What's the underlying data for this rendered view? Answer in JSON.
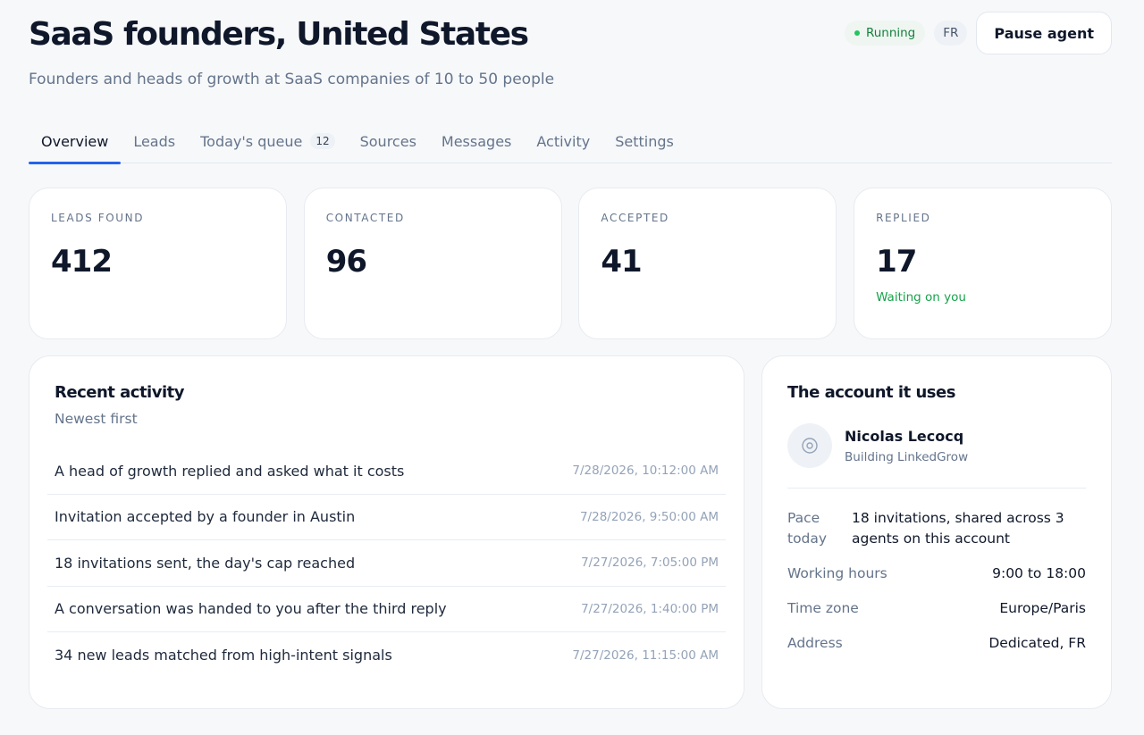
{
  "header": {
    "title": "SaaS founders, United States",
    "subtitle": "Founders and heads of growth at SaaS companies of 10 to 50 people",
    "status_label": "Running",
    "status_color": "#22c55e",
    "language": "FR",
    "pause_label": "Pause agent"
  },
  "tabs": [
    {
      "label": "Overview",
      "active": true
    },
    {
      "label": "Leads"
    },
    {
      "label": "Today's queue",
      "count": "12"
    },
    {
      "label": "Sources"
    },
    {
      "label": "Messages"
    },
    {
      "label": "Activity"
    },
    {
      "label": "Settings"
    }
  ],
  "stats": [
    {
      "label": "LEADS FOUND",
      "value": "412"
    },
    {
      "label": "CONTACTED",
      "value": "96"
    },
    {
      "label": "ACCEPTED",
      "value": "41"
    },
    {
      "label": "REPLIED",
      "value": "17",
      "note": "Waiting on you"
    }
  ],
  "activity": {
    "title": "Recent activity",
    "subtitle": "Newest first",
    "items": [
      {
        "text": "A head of growth replied and asked what it costs",
        "time": "7/28/2026, 10:12:00 AM"
      },
      {
        "text": "Invitation accepted by a founder in Austin",
        "time": "7/28/2026, 9:50:00 AM"
      },
      {
        "text": "18 invitations sent, the day's cap reached",
        "time": "7/27/2026, 7:05:00 PM"
      },
      {
        "text": "A conversation was handed to you after the third reply",
        "time": "7/27/2026, 1:40:00 PM"
      },
      {
        "text": "34 new leads matched from high-intent signals",
        "time": "7/27/2026, 11:15:00 AM"
      }
    ]
  },
  "account": {
    "title": "The account it uses",
    "name": "Nicolas Lecocq",
    "role": "Building LinkedGrow",
    "details": [
      {
        "label": "Pace today",
        "value": "18 invitations, shared across 3 agents on this account"
      },
      {
        "label": "Working hours",
        "value": "9:00 to 18:00"
      },
      {
        "label": "Time zone",
        "value": "Europe/Paris"
      },
      {
        "label": "Address",
        "value": "Dedicated, FR"
      }
    ]
  },
  "colors": {
    "accent": "#2563eb",
    "success": "#16a34a"
  }
}
